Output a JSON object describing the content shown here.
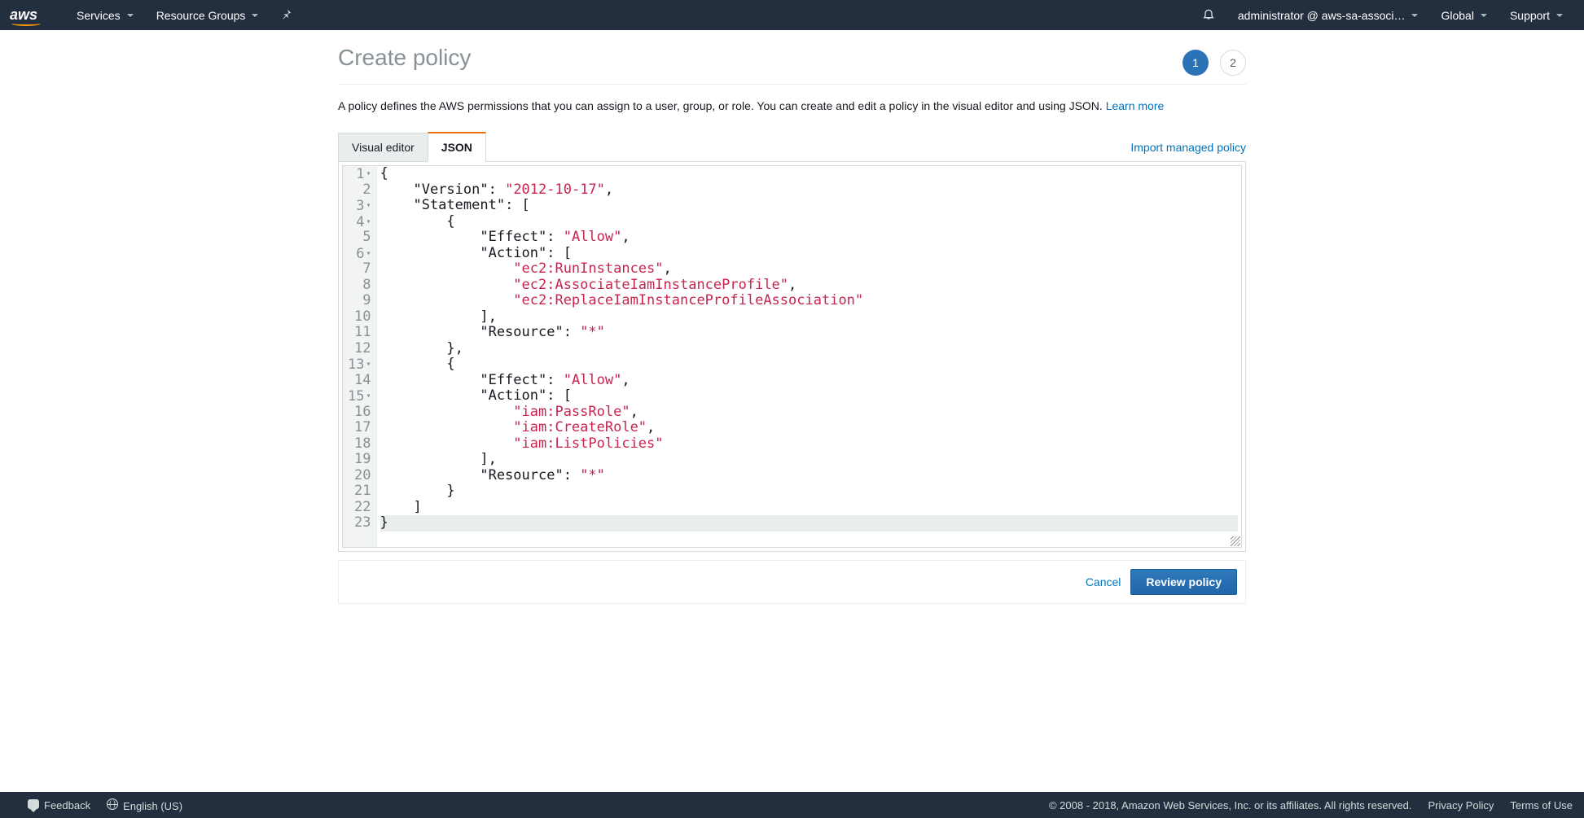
{
  "nav": {
    "logo": "aws",
    "services": "Services",
    "resource_groups": "Resource Groups",
    "user": "administrator @ aws-sa-associ…",
    "region": "Global",
    "support": "Support"
  },
  "page": {
    "title": "Create policy",
    "step_active": "1",
    "step_inactive": "2",
    "description_pre": "A policy defines the AWS permissions that you can assign to a user, group, or role. You can create and edit a policy in the visual editor and using JSON. ",
    "learn_more": "Learn more",
    "tabs": {
      "visual_editor": "Visual editor",
      "json": "JSON"
    },
    "import_link": "Import managed policy"
  },
  "editor": {
    "lines": [
      {
        "n": "1",
        "fold": true,
        "tokens": [
          {
            "t": "punc",
            "v": "{"
          }
        ]
      },
      {
        "n": "2",
        "tokens": [
          {
            "t": "punc",
            "v": "    "
          },
          {
            "t": "key",
            "v": "\"Version\""
          },
          {
            "t": "punc",
            "v": ": "
          },
          {
            "t": "str",
            "v": "\"2012-10-17\""
          },
          {
            "t": "punc",
            "v": ","
          }
        ]
      },
      {
        "n": "3",
        "fold": true,
        "tokens": [
          {
            "t": "punc",
            "v": "    "
          },
          {
            "t": "key",
            "v": "\"Statement\""
          },
          {
            "t": "punc",
            "v": ": ["
          }
        ]
      },
      {
        "n": "4",
        "fold": true,
        "tokens": [
          {
            "t": "punc",
            "v": "        {"
          }
        ]
      },
      {
        "n": "5",
        "tokens": [
          {
            "t": "punc",
            "v": "            "
          },
          {
            "t": "key",
            "v": "\"Effect\""
          },
          {
            "t": "punc",
            "v": ": "
          },
          {
            "t": "str",
            "v": "\"Allow\""
          },
          {
            "t": "punc",
            "v": ","
          }
        ]
      },
      {
        "n": "6",
        "fold": true,
        "tokens": [
          {
            "t": "punc",
            "v": "            "
          },
          {
            "t": "key",
            "v": "\"Action\""
          },
          {
            "t": "punc",
            "v": ": ["
          }
        ]
      },
      {
        "n": "7",
        "tokens": [
          {
            "t": "punc",
            "v": "                "
          },
          {
            "t": "str",
            "v": "\"ec2:RunInstances\""
          },
          {
            "t": "punc",
            "v": ","
          }
        ]
      },
      {
        "n": "8",
        "tokens": [
          {
            "t": "punc",
            "v": "                "
          },
          {
            "t": "str",
            "v": "\"ec2:AssociateIamInstanceProfile\""
          },
          {
            "t": "punc",
            "v": ","
          }
        ]
      },
      {
        "n": "9",
        "tokens": [
          {
            "t": "punc",
            "v": "                "
          },
          {
            "t": "str",
            "v": "\"ec2:ReplaceIamInstanceProfileAssociation\""
          }
        ]
      },
      {
        "n": "10",
        "tokens": [
          {
            "t": "punc",
            "v": "            ],"
          }
        ]
      },
      {
        "n": "11",
        "tokens": [
          {
            "t": "punc",
            "v": "            "
          },
          {
            "t": "key",
            "v": "\"Resource\""
          },
          {
            "t": "punc",
            "v": ": "
          },
          {
            "t": "str",
            "v": "\"*\""
          }
        ]
      },
      {
        "n": "12",
        "tokens": [
          {
            "t": "punc",
            "v": "        },"
          }
        ]
      },
      {
        "n": "13",
        "fold": true,
        "tokens": [
          {
            "t": "punc",
            "v": "        {"
          }
        ]
      },
      {
        "n": "14",
        "tokens": [
          {
            "t": "punc",
            "v": "            "
          },
          {
            "t": "key",
            "v": "\"Effect\""
          },
          {
            "t": "punc",
            "v": ": "
          },
          {
            "t": "str",
            "v": "\"Allow\""
          },
          {
            "t": "punc",
            "v": ","
          }
        ]
      },
      {
        "n": "15",
        "fold": true,
        "tokens": [
          {
            "t": "punc",
            "v": "            "
          },
          {
            "t": "key",
            "v": "\"Action\""
          },
          {
            "t": "punc",
            "v": ": ["
          }
        ]
      },
      {
        "n": "16",
        "tokens": [
          {
            "t": "punc",
            "v": "                "
          },
          {
            "t": "str",
            "v": "\"iam:PassRole\""
          },
          {
            "t": "punc",
            "v": ","
          }
        ]
      },
      {
        "n": "17",
        "tokens": [
          {
            "t": "punc",
            "v": "                "
          },
          {
            "t": "str",
            "v": "\"iam:CreateRole\""
          },
          {
            "t": "punc",
            "v": ","
          }
        ]
      },
      {
        "n": "18",
        "tokens": [
          {
            "t": "punc",
            "v": "                "
          },
          {
            "t": "str",
            "v": "\"iam:ListPolicies\""
          }
        ]
      },
      {
        "n": "19",
        "tokens": [
          {
            "t": "punc",
            "v": "            ],"
          }
        ]
      },
      {
        "n": "20",
        "tokens": [
          {
            "t": "punc",
            "v": "            "
          },
          {
            "t": "key",
            "v": "\"Resource\""
          },
          {
            "t": "punc",
            "v": ": "
          },
          {
            "t": "str",
            "v": "\"*\""
          }
        ]
      },
      {
        "n": "21",
        "tokens": [
          {
            "t": "punc",
            "v": "        }"
          }
        ]
      },
      {
        "n": "22",
        "tokens": [
          {
            "t": "punc",
            "v": "    ]"
          }
        ]
      },
      {
        "n": "23",
        "hl": true,
        "tokens": [
          {
            "t": "punc",
            "v": "}"
          }
        ]
      }
    ]
  },
  "actions": {
    "cancel": "Cancel",
    "review": "Review policy"
  },
  "footer": {
    "feedback": "Feedback",
    "language": "English (US)",
    "copyright": "© 2008 - 2018, Amazon Web Services, Inc. or its affiliates. All rights reserved.",
    "privacy": "Privacy Policy",
    "terms": "Terms of Use"
  }
}
